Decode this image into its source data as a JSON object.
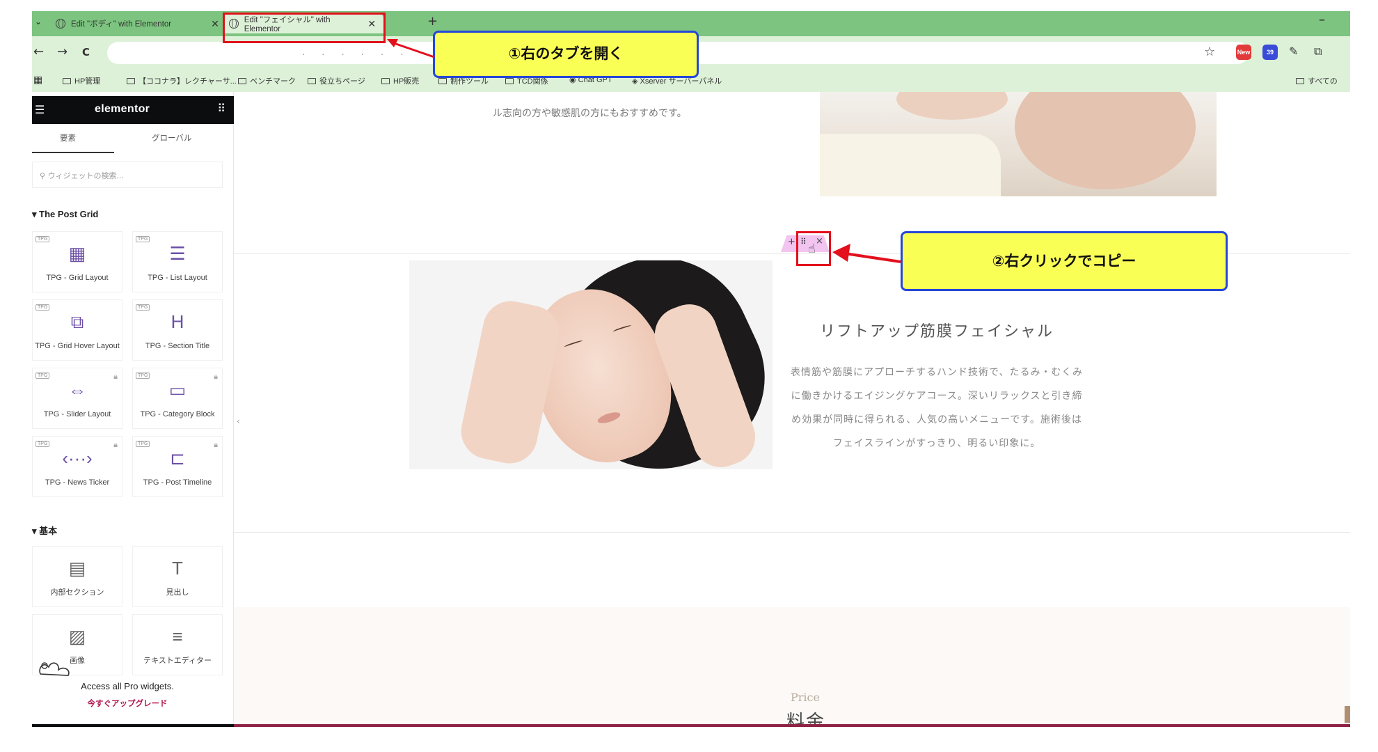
{
  "browser": {
    "tabs": [
      {
        "label": "Edit \"ボディ\" with Elementor",
        "active": false
      },
      {
        "label": "Edit \"フェイシャル\" with Elementor",
        "active": true
      }
    ],
    "new_tab": "+",
    "close": "✕",
    "minimize": "–",
    "nav": {
      "back": "←",
      "forward": "→",
      "reload": "C"
    },
    "address_masked": ". . . . . .",
    "bookmarks": [
      "HP管理",
      "【ココナラ】レクチャーサ...",
      "ベンチマーク",
      "役立ちページ",
      "HP販売",
      "制作ツール",
      "TCD関係",
      "Chat GPT",
      "Xserver サーバーパネル",
      "すべての"
    ],
    "extensions": [
      {
        "label": "New",
        "color": "#e23a3a"
      },
      {
        "label": "39",
        "color": "#3a4bd8"
      }
    ]
  },
  "elementor": {
    "logo": "elementor",
    "tabs": [
      "要素",
      "グローバル"
    ],
    "search_placeholder": "ウィジェットの検索...",
    "section_post_grid": "The Post Grid",
    "badge": "TPG",
    "post_grid_widgets": [
      {
        "label": "TPG - Grid Layout",
        "icon": "grid-layout-icon",
        "glyph": "▦",
        "locked": false
      },
      {
        "label": "TPG - List Layout",
        "icon": "list-layout-icon",
        "glyph": "☰",
        "locked": false
      },
      {
        "label": "TPG - Grid Hover Layout",
        "icon": "grid-hover-icon",
        "glyph": "⧉",
        "locked": false
      },
      {
        "label": "TPG - Section Title",
        "icon": "section-title-icon",
        "glyph": "H",
        "locked": false
      },
      {
        "label": "TPG - Slider Layout",
        "icon": "slider-icon",
        "glyph": "⇔",
        "locked": true
      },
      {
        "label": "TPG - Category Block",
        "icon": "folder-icon",
        "glyph": "▭",
        "locked": true
      },
      {
        "label": "TPG - News Ticker",
        "icon": "ticker-icon",
        "glyph": "‹···›",
        "locked": true
      },
      {
        "label": "TPG - Post Timeline",
        "icon": "timeline-icon",
        "glyph": "⊏",
        "locked": true
      }
    ],
    "section_basic": "基本",
    "basic_widgets": [
      {
        "label": "内部セクション",
        "icon": "inner-section-icon",
        "glyph": "▤"
      },
      {
        "label": "見出し",
        "icon": "heading-icon",
        "glyph": "T"
      },
      {
        "label": "画像",
        "icon": "image-icon",
        "glyph": "▨"
      },
      {
        "label": "テキストエディター",
        "icon": "text-editor-icon",
        "glyph": "≡"
      }
    ],
    "pro_text": "Access all Pro widgets.",
    "upgrade_link": "今すぐアップグレード"
  },
  "canvas": {
    "top_text": "ル志向の方や敏感肌の方にもおすすめです。",
    "section_title": "リフトアップ筋膜フェイシャル",
    "description_lines": [
      "表情筋や筋膜にアプローチするハンド技術で、たるみ・むくみ",
      "に働きかけるエイジングケアコース。深いリラックスと引き締",
      "め効果が同時に得られる、人気の高いメニューです。施術後は",
      "フェイスラインがすっきり、明るい印象に。"
    ],
    "price_label": "Price",
    "price_title": "料金",
    "collapse": "‹"
  },
  "annotations": {
    "callout1": "①右のタブを開く",
    "callout2": "②右クリックでコピー",
    "highlight_color": "#e3101c",
    "callout_fill": "#faff55",
    "callout_border": "#2747d8"
  }
}
